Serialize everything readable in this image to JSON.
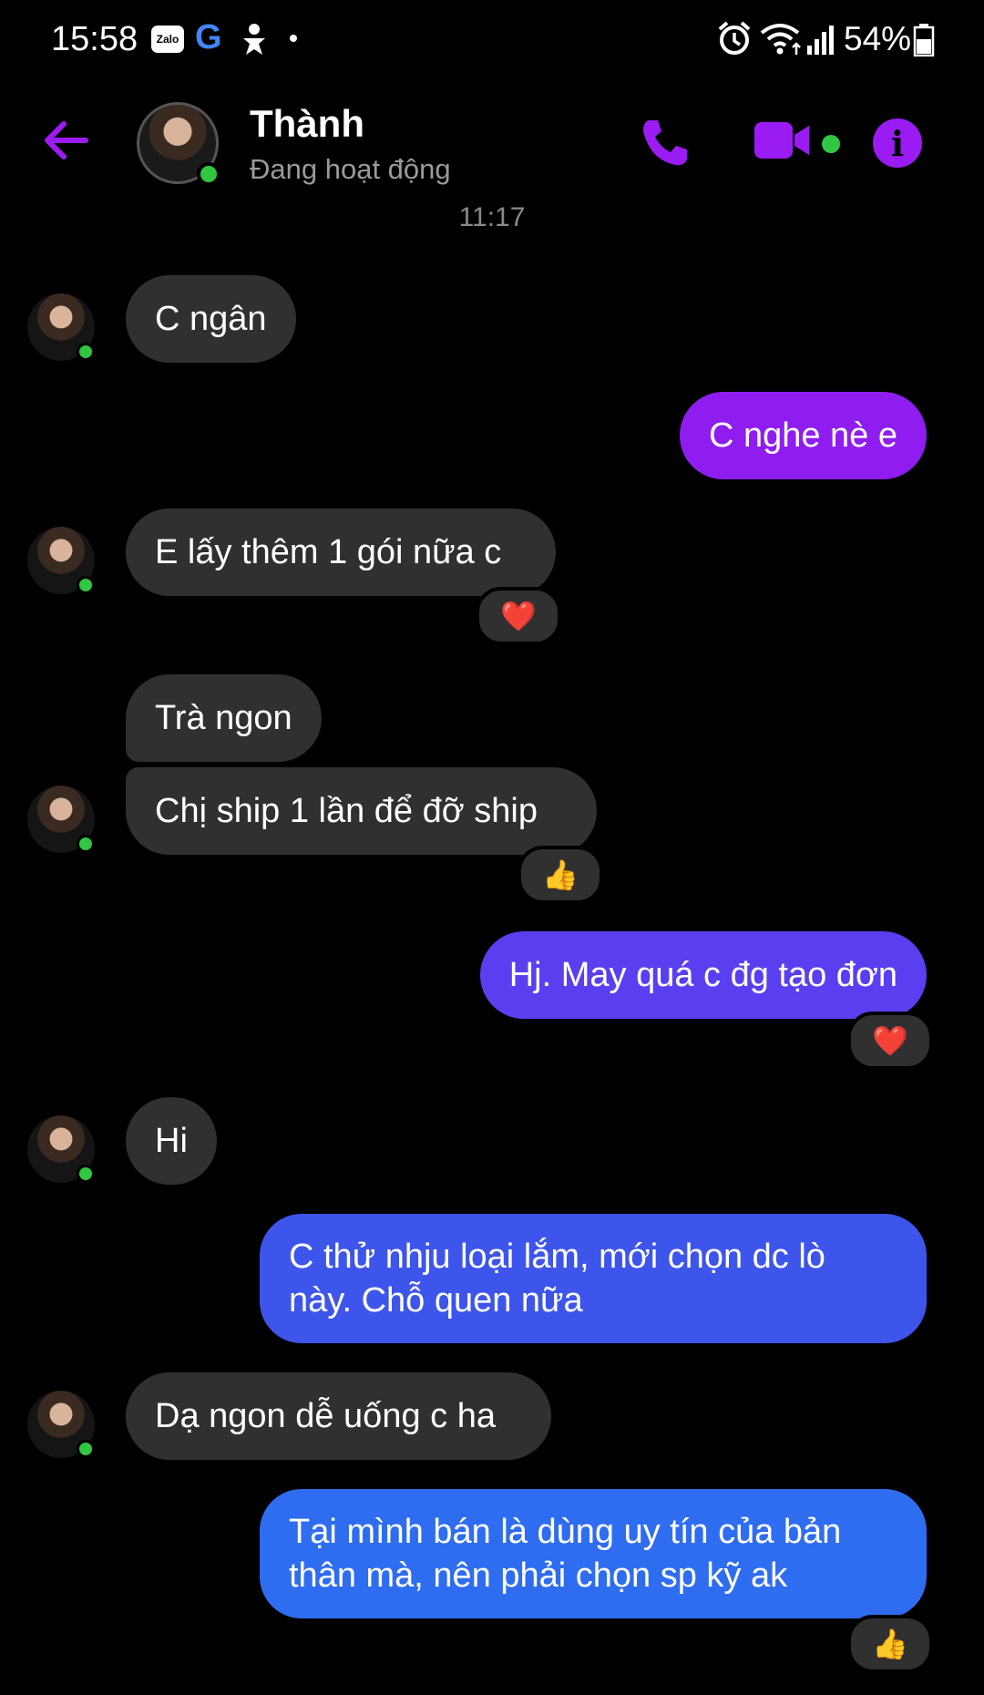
{
  "status_bar": {
    "time": "15:58",
    "zalo_label": "Zalo",
    "g_label": "G",
    "battery": "54%"
  },
  "header": {
    "contact_name": "Thành",
    "contact_status": "Đang hoạt động"
  },
  "timestamp": "11:17",
  "messages": [
    {
      "from": "them",
      "text": "C ngân"
    },
    {
      "from": "me",
      "text": "C nghe nè e"
    },
    {
      "from": "them",
      "text": "E lấy thêm 1 gói nữa c",
      "reaction": "❤️"
    },
    {
      "from": "them",
      "text": "Trà ngon"
    },
    {
      "from": "them",
      "text": "Chị ship 1 lần để đỡ ship",
      "reaction": "👍"
    },
    {
      "from": "me",
      "text": "Hj. May quá c đg tạo đơn",
      "reaction": "❤️"
    },
    {
      "from": "them",
      "text": "Hi"
    },
    {
      "from": "me",
      "text": "C thử nhju loại lắm, mới chọn dc lò này. Chỗ quen nữa"
    },
    {
      "from": "them",
      "text": "Dạ ngon dễ uống c ha"
    },
    {
      "from": "me",
      "text": "Tại mình bán là dùng uy tín của bản thân mà, nên phải chọn sp kỹ ak",
      "reaction": "👍"
    }
  ],
  "colors": {
    "accent": "#9b1cf2",
    "incoming_bubble": "#303030",
    "outgoing_1": "#8f1df0",
    "outgoing_2": "#5a3ff0",
    "outgoing_3": "#3e55ec",
    "outgoing_4": "#2f6df0",
    "online": "#31c742"
  }
}
